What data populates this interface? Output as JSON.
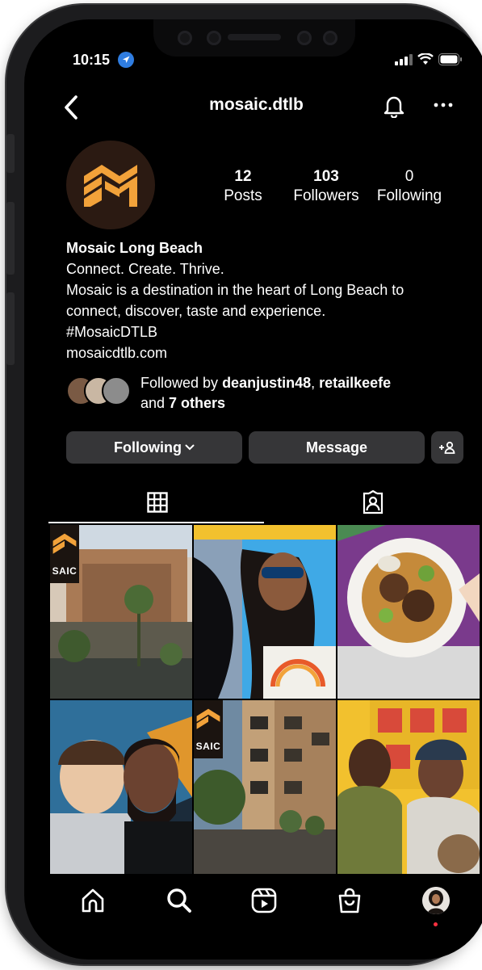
{
  "status_bar": {
    "time": "10:15"
  },
  "header": {
    "username": "mosaic.dtlb"
  },
  "profile": {
    "stats": [
      {
        "value": "12",
        "label": "Posts"
      },
      {
        "value": "103",
        "label": "Followers"
      },
      {
        "value": "0",
        "label": "Following"
      }
    ],
    "name": "Mosaic Long Beach",
    "bio_lines": [
      "Connect. Create. Thrive.",
      "Mosaic is a destination in the heart of Long Beach to",
      "connect, discover, taste and experience.",
      "#MosaicDTLB"
    ],
    "link": "mosaicdtlb.com",
    "followed_by": {
      "prefix": "Followed by ",
      "user1": "deanjustin48",
      "separator": ", ",
      "user2": "retailkeefe",
      "and": "and ",
      "others": "7 others"
    }
  },
  "buttons": {
    "following": "Following",
    "message": "Message"
  },
  "grid": {
    "badges": [
      "SAIC",
      "SAIC"
    ]
  },
  "colors": {
    "background": "#000000",
    "button": "#363638",
    "accent": "#f2a23a",
    "notification_dot": "#ff3040"
  }
}
